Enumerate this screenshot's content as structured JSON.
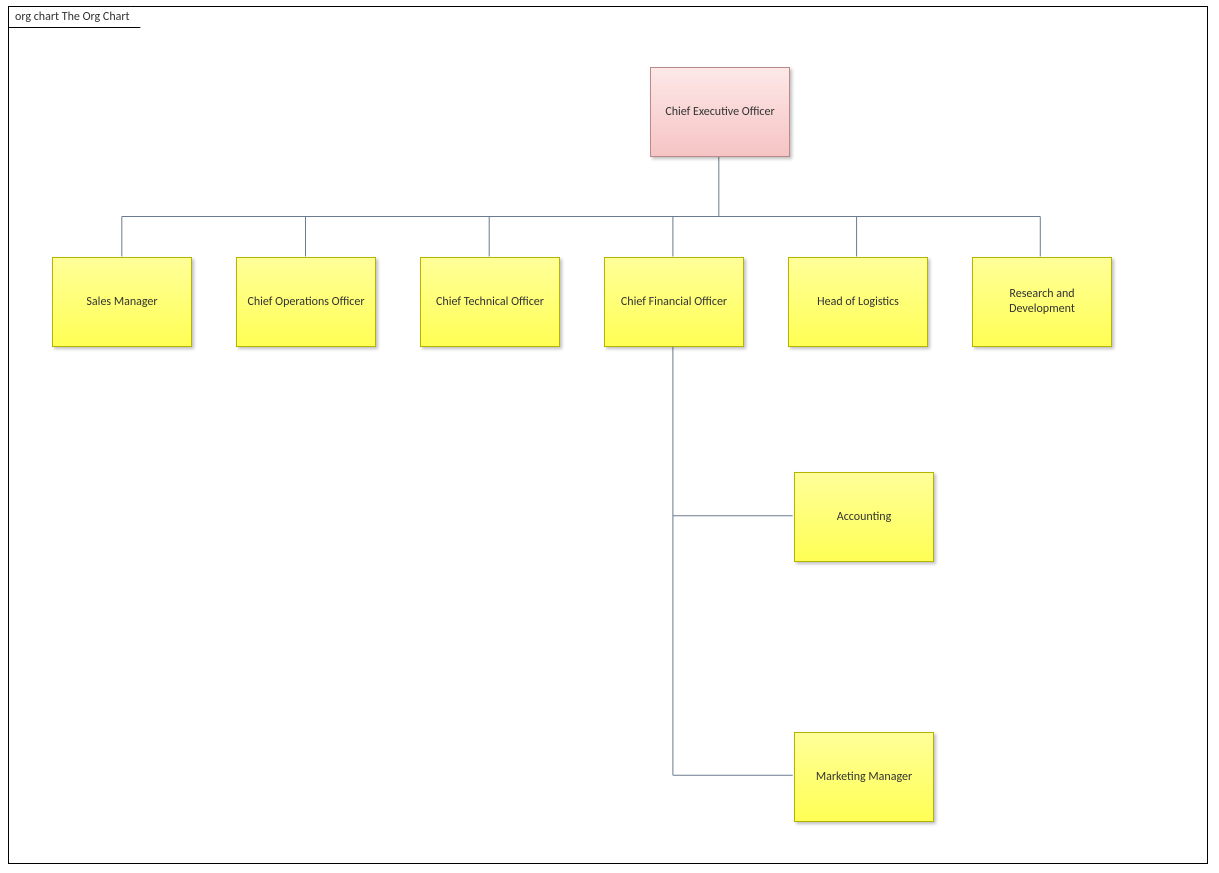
{
  "frame_title": "org chart The Org Chart",
  "nodes": {
    "ceo": "Chief Executive Officer",
    "sales_manager": "Sales Manager",
    "coo": "Chief Operations Officer",
    "cto": "Chief Technical Officer",
    "cfo": "Chief Financial Officer",
    "head_logistics": "Head of Logistics",
    "rnd": "Research and Development",
    "accounting": "Accounting",
    "marketing_manager": "Marketing Manager"
  },
  "colors": {
    "root_fill_top": "#fde8e8",
    "root_fill_bottom": "#f6c4c4",
    "child_fill_top": "#ffff99",
    "child_fill_bottom": "#ffff55",
    "connector": "#6b7a8f"
  },
  "chart_data": {
    "type": "tree",
    "title": "org chart The Org Chart",
    "root": {
      "label": "Chief Executive Officer",
      "children": [
        {
          "label": "Sales Manager"
        },
        {
          "label": "Chief Operations Officer"
        },
        {
          "label": "Chief Technical Officer"
        },
        {
          "label": "Chief Financial Officer",
          "children": [
            {
              "label": "Accounting"
            },
            {
              "label": "Marketing Manager"
            }
          ]
        },
        {
          "label": "Head of Logistics"
        },
        {
          "label": "Research and Development"
        }
      ]
    }
  }
}
